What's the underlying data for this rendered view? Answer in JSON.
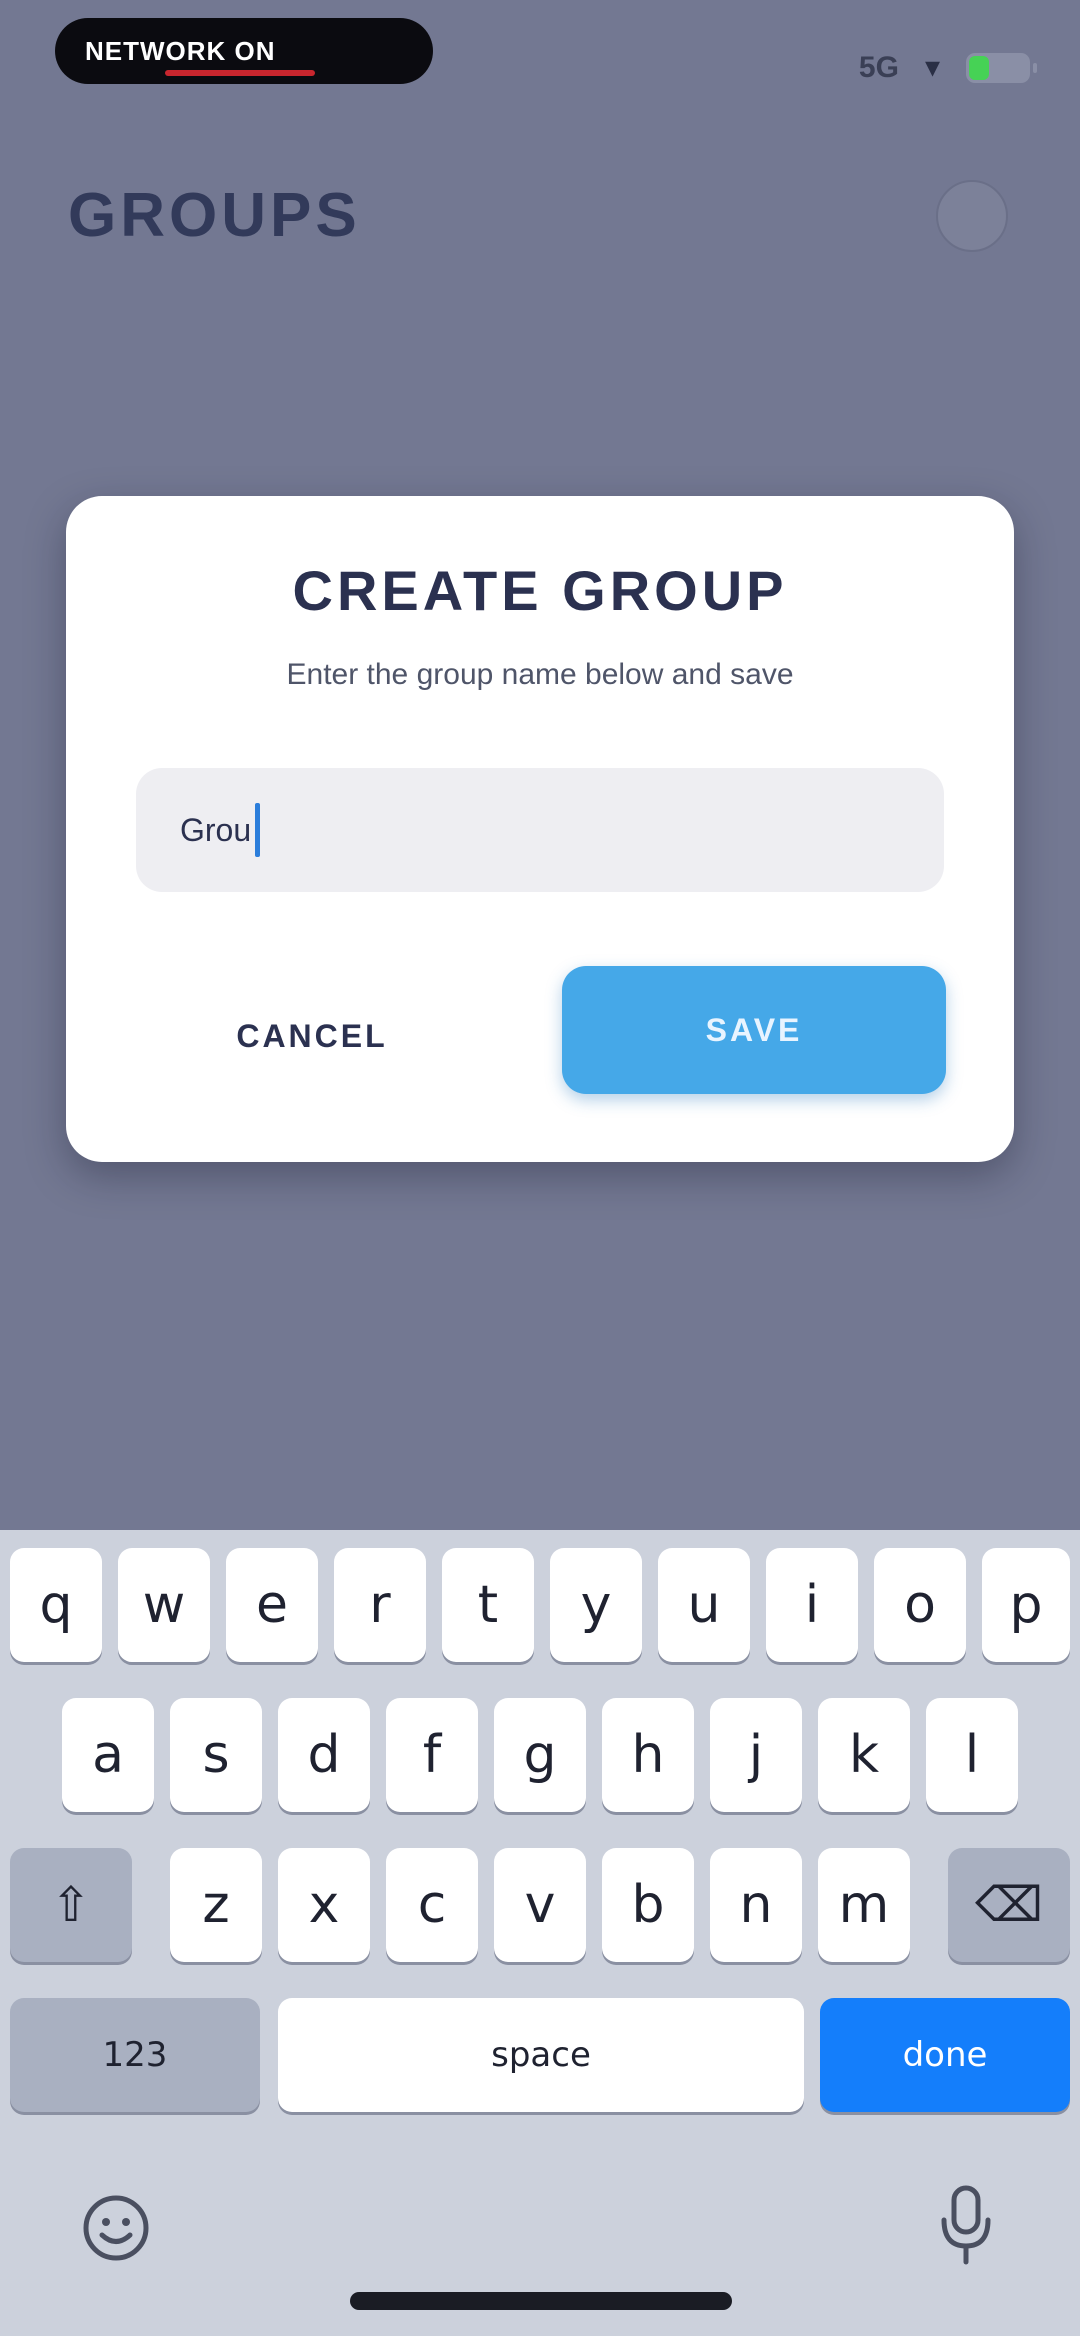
{
  "status_bar": {
    "pill_text": "NETWORK ON",
    "signal_text": "5G",
    "wifi_glyph": "▾",
    "battery_level": 0.35
  },
  "header": {
    "title": "GROUPS"
  },
  "dialog": {
    "title": "CREATE GROUP",
    "subtitle": "Enter the group name below and save",
    "input_value": "Grou",
    "cancel_label": "CANCEL",
    "save_label": "SAVE"
  },
  "keyboard": {
    "row1": [
      "q",
      "w",
      "e",
      "r",
      "t",
      "y",
      "u",
      "i",
      "o",
      "p"
    ],
    "row2": [
      "a",
      "s",
      "d",
      "f",
      "g",
      "h",
      "j",
      "k",
      "l"
    ],
    "row3": [
      "z",
      "x",
      "c",
      "v",
      "b",
      "n",
      "m"
    ],
    "shift_glyph": "⇧",
    "backspace_glyph": "⌫",
    "numbers_label": "123",
    "space_label": "space",
    "done_label": "done"
  },
  "colors": {
    "backdrop": "#737892",
    "accent_save": "#45a8e8",
    "keyboard_done": "#147efb",
    "title_text": "#2b3150"
  },
  "icons": {
    "emoji": "emoji-icon",
    "mic": "microphone-icon",
    "avatar": "profile-avatar"
  }
}
